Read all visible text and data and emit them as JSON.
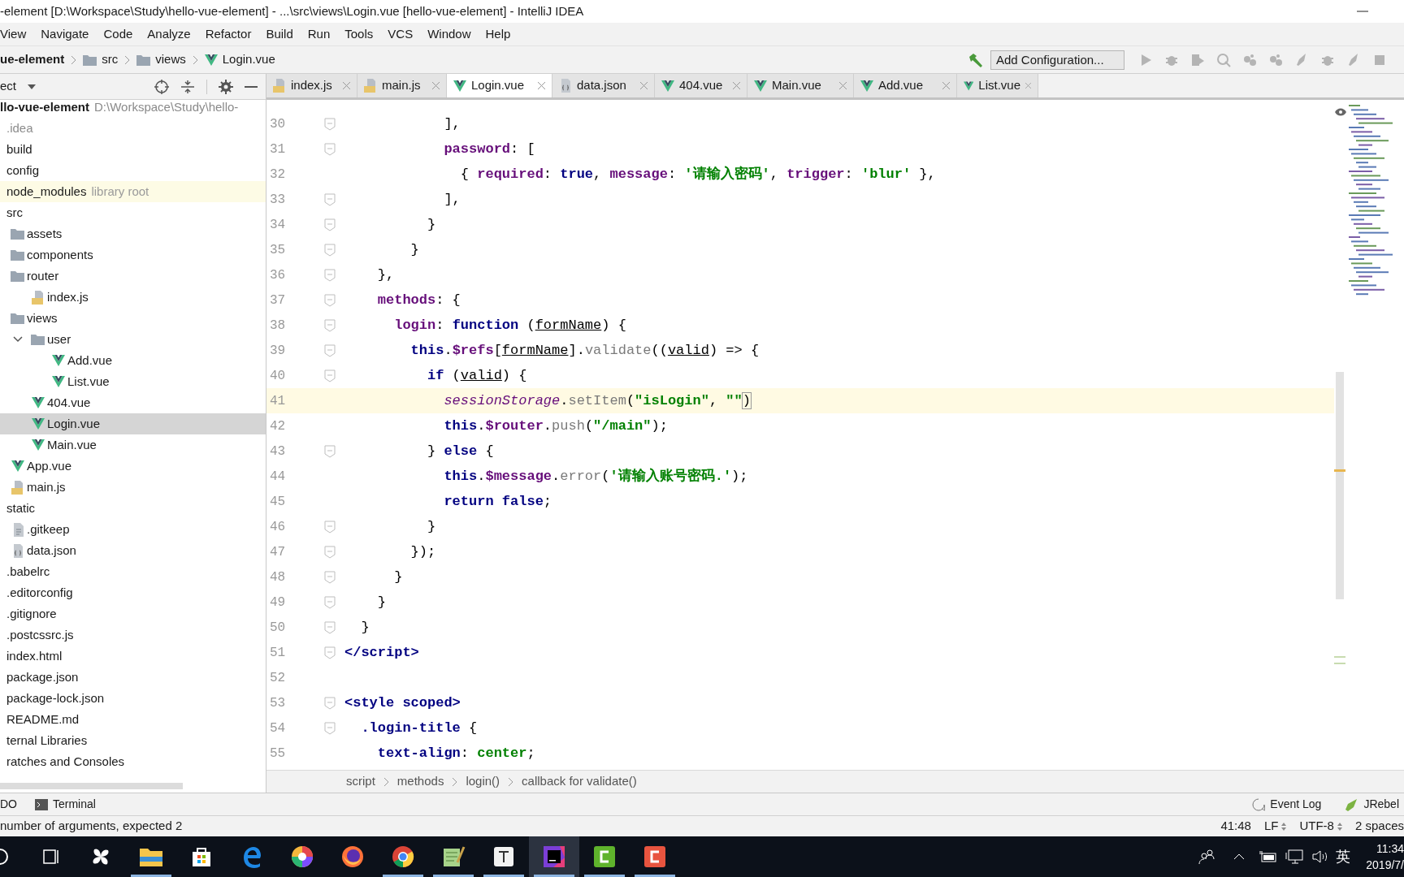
{
  "title_bar": {
    "title": "-element [D:\\Workspace\\Study\\hello-vue-element] - ...\\src\\views\\Login.vue [hello-vue-element] - IntelliJ IDEA"
  },
  "menu": [
    "View",
    "Navigate",
    "Code",
    "Analyze",
    "Refactor",
    "Build",
    "Run",
    "Tools",
    "VCS",
    "Window",
    "Help"
  ],
  "nav_bar": {
    "breadcrumb": [
      {
        "label": "ue-element",
        "kind": "project"
      },
      {
        "label": "src",
        "kind": "folder"
      },
      {
        "label": "views",
        "kind": "folder"
      },
      {
        "label": "Login.vue",
        "kind": "vue"
      }
    ],
    "run_config": "Add Configuration..."
  },
  "project_panel": {
    "title": "ect",
    "root": {
      "name": "llo-vue-element",
      "path": "D:\\Workspace\\Study\\hello-"
    },
    "tree": [
      {
        "name": ".idea",
        "kind": "excluded",
        "selected": false
      },
      {
        "name": "build",
        "kind": "folder",
        "selected": false
      },
      {
        "name": "config",
        "kind": "folder",
        "selected": false
      },
      {
        "name": "node_modules",
        "kind": "library",
        "note": "library root",
        "selected": false
      },
      {
        "name": "src",
        "kind": "folder",
        "selected": false,
        "children": [
          {
            "name": "assets",
            "kind": "folder",
            "selected": false
          },
          {
            "name": "components",
            "kind": "folder",
            "selected": false
          },
          {
            "name": "router",
            "kind": "folder",
            "selected": false,
            "children": [
              {
                "name": "index.js",
                "kind": "js",
                "selected": false
              }
            ]
          },
          {
            "name": "views",
            "kind": "folder",
            "selected": false,
            "children": [
              {
                "name": "user",
                "kind": "folder",
                "expanded": true,
                "selected": false,
                "children": [
                  {
                    "name": "Add.vue",
                    "kind": "vue",
                    "selected": false
                  },
                  {
                    "name": "List.vue",
                    "kind": "vue",
                    "selected": false
                  }
                ]
              },
              {
                "name": "404.vue",
                "kind": "vue",
                "selected": false
              },
              {
                "name": "Login.vue",
                "kind": "vue",
                "selected": true
              },
              {
                "name": "Main.vue",
                "kind": "vue",
                "selected": false
              }
            ]
          },
          {
            "name": "App.vue",
            "kind": "vue",
            "selected": false
          },
          {
            "name": "main.js",
            "kind": "js",
            "selected": false
          }
        ]
      },
      {
        "name": "static",
        "kind": "folder",
        "selected": false,
        "children": [
          {
            "name": ".gitkeep",
            "kind": "text",
            "selected": false
          },
          {
            "name": "data.json",
            "kind": "json",
            "selected": false
          }
        ]
      },
      {
        "name": ".babelrc",
        "kind": "config",
        "selected": false
      },
      {
        "name": ".editorconfig",
        "kind": "config",
        "selected": false
      },
      {
        "name": ".gitignore",
        "kind": "config",
        "selected": false
      },
      {
        "name": ".postcssrc.js",
        "kind": "js",
        "selected": false
      },
      {
        "name": "index.html",
        "kind": "html",
        "selected": false
      },
      {
        "name": "package.json",
        "kind": "json",
        "selected": false
      },
      {
        "name": "package-lock.json",
        "kind": "json",
        "selected": false
      },
      {
        "name": "README.md",
        "kind": "md",
        "selected": false
      },
      {
        "name": "ternal Libraries",
        "kind": "group",
        "selected": false
      },
      {
        "name": "ratches and Consoles",
        "kind": "group",
        "selected": false
      }
    ]
  },
  "editor": {
    "tabs": [
      {
        "label": "index.js",
        "kind": "js",
        "selected": false
      },
      {
        "label": "main.js",
        "kind": "js",
        "selected": false
      },
      {
        "label": "Login.vue",
        "kind": "vue",
        "selected": true
      },
      {
        "label": "data.json",
        "kind": "json",
        "selected": false
      },
      {
        "label": "404.vue",
        "kind": "vue",
        "selected": false
      },
      {
        "label": "Main.vue",
        "kind": "vue",
        "selected": false
      },
      {
        "label": "Add.vue",
        "kind": "vue",
        "selected": false
      },
      {
        "label": "List.vue",
        "kind": "vue",
        "selected": false
      }
    ],
    "lines": [
      {
        "number": "30",
        "fold": true,
        "current": false,
        "tokens": [
          {
            "kind": "plain",
            "text": "            ],"
          }
        ]
      },
      {
        "number": "31",
        "fold": true,
        "current": false,
        "tokens": [
          {
            "kind": "field",
            "text": "            password"
          },
          {
            "kind": "plain",
            "text": ": ["
          }
        ]
      },
      {
        "number": "32",
        "fold": false,
        "current": false,
        "tokens": [
          {
            "kind": "plain",
            "text": "              { "
          },
          {
            "kind": "field",
            "text": "required"
          },
          {
            "kind": "plain",
            "text": ": "
          },
          {
            "kind": "keyword",
            "text": "true"
          },
          {
            "kind": "plain",
            "text": ", "
          },
          {
            "kind": "field",
            "text": "message"
          },
          {
            "kind": "plain",
            "text": ": "
          },
          {
            "kind": "string",
            "text": "'请输入密码'"
          },
          {
            "kind": "plain",
            "text": ", "
          },
          {
            "kind": "field",
            "text": "trigger"
          },
          {
            "kind": "plain",
            "text": ": "
          },
          {
            "kind": "string",
            "text": "'blur'"
          },
          {
            "kind": "plain",
            "text": " },"
          }
        ]
      },
      {
        "number": "33",
        "fold": true,
        "current": false,
        "tokens": [
          {
            "kind": "plain",
            "text": "            ],"
          }
        ]
      },
      {
        "number": "34",
        "fold": true,
        "current": false,
        "tokens": [
          {
            "kind": "plain",
            "text": "          }"
          }
        ]
      },
      {
        "number": "35",
        "fold": true,
        "current": false,
        "tokens": [
          {
            "kind": "plain",
            "text": "        }"
          }
        ]
      },
      {
        "number": "36",
        "fold": true,
        "current": false,
        "tokens": [
          {
            "kind": "plain",
            "text": "    },"
          }
        ]
      },
      {
        "number": "37",
        "fold": true,
        "current": false,
        "tokens": [
          {
            "kind": "field",
            "text": "    methods"
          },
          {
            "kind": "plain",
            "text": ": {"
          }
        ]
      },
      {
        "number": "38",
        "fold": true,
        "current": false,
        "tokens": [
          {
            "kind": "field",
            "text": "      login"
          },
          {
            "kind": "plain",
            "text": ": "
          },
          {
            "kind": "keyword",
            "text": "function"
          },
          {
            "kind": "plain",
            "text": " ("
          },
          {
            "kind": "param",
            "text": "formName"
          },
          {
            "kind": "plain",
            "text": ") {"
          }
        ]
      },
      {
        "number": "39",
        "fold": true,
        "current": false,
        "tokens": [
          {
            "kind": "keyword",
            "text": "        this"
          },
          {
            "kind": "plain",
            "text": "."
          },
          {
            "kind": "field",
            "text": "$refs"
          },
          {
            "kind": "plain",
            "text": "["
          },
          {
            "kind": "param",
            "text": "formName"
          },
          {
            "kind": "plain",
            "text": "]."
          },
          {
            "kind": "method",
            "text": "validate"
          },
          {
            "kind": "plain",
            "text": "(("
          },
          {
            "kind": "param",
            "text": "valid"
          },
          {
            "kind": "plain",
            "text": ") => {"
          }
        ]
      },
      {
        "number": "40",
        "fold": true,
        "current": false,
        "tokens": [
          {
            "kind": "keyword",
            "text": "          if"
          },
          {
            "kind": "plain",
            "text": " ("
          },
          {
            "kind": "param",
            "text": "valid"
          },
          {
            "kind": "plain",
            "text": ") {"
          }
        ]
      },
      {
        "number": "41",
        "fold": false,
        "current": true,
        "tokens": [
          {
            "kind": "global",
            "text": "            sessionStorage"
          },
          {
            "kind": "plain",
            "text": "."
          },
          {
            "kind": "method",
            "text": "setItem"
          },
          {
            "kind": "plain",
            "text": "("
          },
          {
            "kind": "string",
            "text": "\"isLogin\""
          },
          {
            "kind": "plain",
            "text": ", "
          },
          {
            "kind": "string",
            "text": "\"\""
          },
          {
            "kind": "brace",
            "text": ")"
          }
        ]
      },
      {
        "number": "42",
        "fold": false,
        "current": false,
        "tokens": [
          {
            "kind": "keyword",
            "text": "            this"
          },
          {
            "kind": "plain",
            "text": "."
          },
          {
            "kind": "field",
            "text": "$router"
          },
          {
            "kind": "plain",
            "text": "."
          },
          {
            "kind": "method",
            "text": "push"
          },
          {
            "kind": "plain",
            "text": "("
          },
          {
            "kind": "string",
            "text": "\"/main\""
          },
          {
            "kind": "plain",
            "text": ");"
          }
        ]
      },
      {
        "number": "43",
        "fold": true,
        "current": false,
        "tokens": [
          {
            "kind": "plain",
            "text": "          } "
          },
          {
            "kind": "keyword",
            "text": "else"
          },
          {
            "kind": "plain",
            "text": " {"
          }
        ]
      },
      {
        "number": "44",
        "fold": false,
        "current": false,
        "tokens": [
          {
            "kind": "keyword",
            "text": "            this"
          },
          {
            "kind": "plain",
            "text": "."
          },
          {
            "kind": "field",
            "text": "$message"
          },
          {
            "kind": "plain",
            "text": "."
          },
          {
            "kind": "method",
            "text": "error"
          },
          {
            "kind": "plain",
            "text": "("
          },
          {
            "kind": "string",
            "text": "'请输入账号密码.'"
          },
          {
            "kind": "plain",
            "text": ");"
          }
        ]
      },
      {
        "number": "45",
        "fold": false,
        "current": false,
        "tokens": [
          {
            "kind": "keyword",
            "text": "            return false"
          },
          {
            "kind": "plain",
            "text": ";"
          }
        ]
      },
      {
        "number": "46",
        "fold": true,
        "current": false,
        "tokens": [
          {
            "kind": "plain",
            "text": "          }"
          }
        ]
      },
      {
        "number": "47",
        "fold": true,
        "current": false,
        "tokens": [
          {
            "kind": "plain",
            "text": "        });"
          }
        ]
      },
      {
        "number": "48",
        "fold": true,
        "current": false,
        "tokens": [
          {
            "kind": "plain",
            "text": "      }"
          }
        ]
      },
      {
        "number": "49",
        "fold": true,
        "current": false,
        "tokens": [
          {
            "kind": "plain",
            "text": "    }"
          }
        ]
      },
      {
        "number": "50",
        "fold": true,
        "current": false,
        "tokens": [
          {
            "kind": "plain",
            "text": "  }"
          }
        ]
      },
      {
        "number": "51",
        "fold": true,
        "current": false,
        "tokens": [
          {
            "kind": "tag",
            "text": "</script>"
          }
        ]
      },
      {
        "number": "52",
        "fold": false,
        "current": false
      },
      {
        "number": "53",
        "fold": true,
        "current": false,
        "tokens": [
          {
            "kind": "tag",
            "text": "<style scoped>"
          }
        ]
      },
      {
        "number": "54",
        "fold": true,
        "current": false,
        "tokens": [
          {
            "kind": "css",
            "text": "  .login-title"
          },
          {
            "kind": "plain",
            "text": " {"
          }
        ]
      },
      {
        "number": "55",
        "fold": false,
        "current": false,
        "tokens": [
          {
            "kind": "css",
            "text": "    text-align"
          },
          {
            "kind": "plain",
            "text": ": "
          },
          {
            "kind": "string",
            "text": "center"
          },
          {
            "kind": "plain",
            "text": ";"
          }
        ]
      }
    ],
    "breadcrumb": [
      "script",
      "methods",
      "login()",
      "callback for validate()"
    ]
  },
  "tool_bar": {
    "left": [
      {
        "label": "DO",
        "kind": "todo"
      },
      {
        "label": "Terminal",
        "kind": "terminal"
      }
    ],
    "right": [
      {
        "label": "Event Log",
        "kind": "event-log"
      },
      {
        "label": "JRebel",
        "kind": "jrebel"
      }
    ]
  },
  "status_bar": {
    "message": "number of arguments, expected 2",
    "position": "41:48",
    "line_separator": "LF",
    "encoding": "UTF-8",
    "indent": "2 spaces"
  },
  "taskbar": {
    "apps": [
      {
        "kind": "search",
        "running": false,
        "selected": false
      },
      {
        "kind": "taskview",
        "running": false,
        "selected": false
      },
      {
        "kind": "pinwheel",
        "running": false,
        "selected": false
      },
      {
        "kind": "explorer",
        "running": true,
        "selected": false
      },
      {
        "kind": "store",
        "running": false,
        "selected": false
      },
      {
        "kind": "edge",
        "running": false,
        "selected": false
      },
      {
        "kind": "swirl",
        "running": false,
        "selected": false
      },
      {
        "kind": "firefox",
        "running": false,
        "selected": false
      },
      {
        "kind": "chrome",
        "running": true,
        "selected": false
      },
      {
        "kind": "notepad",
        "running": true,
        "selected": false
      },
      {
        "kind": "typora",
        "running": true,
        "selected": false
      },
      {
        "kind": "idea",
        "running": true,
        "selected": true
      },
      {
        "kind": "cgreen",
        "running": true,
        "selected": false
      },
      {
        "kind": "cred",
        "running": true,
        "selected": false
      }
    ],
    "input_method": "英",
    "time": "11:34",
    "date": "2019/7/"
  }
}
